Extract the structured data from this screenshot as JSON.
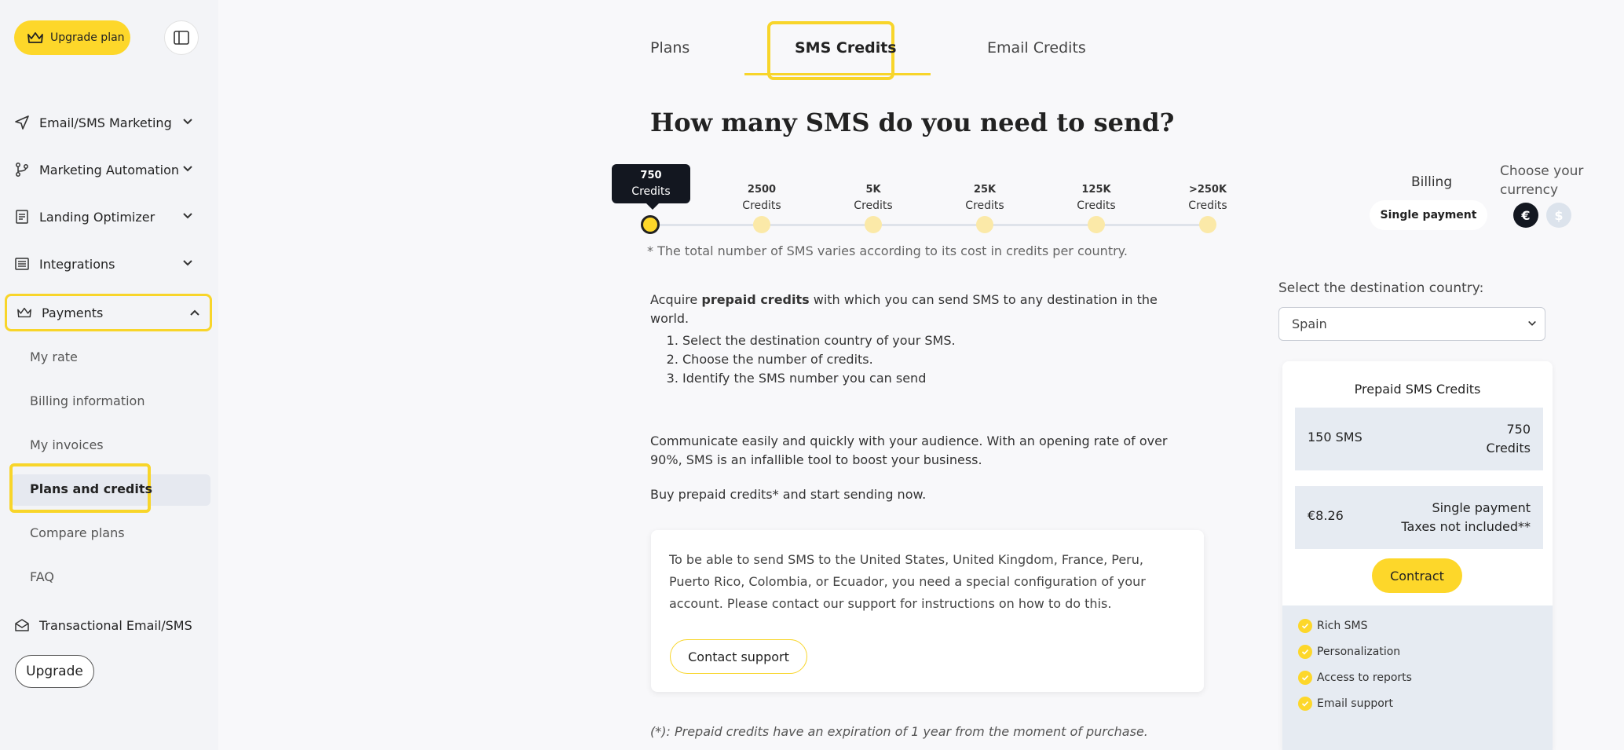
{
  "sidebar": {
    "upgrade_plan_label": "Upgrade plan",
    "nav": [
      {
        "label": "Email/SMS Marketing"
      },
      {
        "label": "Marketing Automation"
      },
      {
        "label": "Landing Optimizer"
      },
      {
        "label": "Integrations"
      },
      {
        "label": "Payments"
      }
    ],
    "payments_sub": [
      "My rate",
      "Billing information",
      "My invoices",
      "Plans and credits",
      "Compare plans",
      "FAQ"
    ],
    "transactional_label": "Transactional Email/SMS",
    "upgrade_label": "Upgrade"
  },
  "tabs": [
    "Plans",
    "SMS Credits",
    "Email Credits"
  ],
  "heading": "How many SMS do you need to send?",
  "slider": {
    "ticks": [
      {
        "num": "750",
        "unit": "Credits"
      },
      {
        "num": "2500",
        "unit": "Credits"
      },
      {
        "num": "5K",
        "unit": "Credits"
      },
      {
        "num": "25K",
        "unit": "Credits"
      },
      {
        "num": "125K",
        "unit": "Credits"
      },
      {
        "num": ">250K",
        "unit": "Credits"
      }
    ],
    "selected_index": 0
  },
  "footnote": "* The total number of SMS varies according to its cost in credits per country.",
  "intro": {
    "pre": "Acquire ",
    "bold": "prepaid credits",
    "post": " with which you can send SMS to any destination in the world."
  },
  "steps": [
    "Select the destination country of your SMS.",
    "Choose the number of credits.",
    "Identify the SMS number you can send"
  ],
  "paragraph1": "Communicate easily and quickly with your audience. With an opening rate of over 90%, SMS is an infallible tool to boost your business.",
  "paragraph2": "Buy prepaid credits* and start sending now.",
  "info_card": {
    "text": "To be able to send SMS to the United States, United Kingdom, France, Peru, Puerto Rico, Colombia, or Ecuador, you need a special configuration of your account. Please contact our support for instructions on how to do this.",
    "button": "Contact support"
  },
  "expiration": "(*): Prepaid credits have an expiration of 1 year from the moment of purchase.",
  "billing": {
    "label": "Billing",
    "value": "Single payment",
    "currency_label": "Choose your currency",
    "currencies": [
      "€",
      "$"
    ]
  },
  "destination": {
    "label": "Select the destination country:",
    "value": "Spain"
  },
  "price_card": {
    "title": "Prepaid SMS Credits",
    "sms": "150 SMS",
    "credits_line1": "750",
    "credits_line2": "Credits",
    "price": "€8.26",
    "payment_line1": "Single payment",
    "payment_line2": "Taxes not included**",
    "contract": "Contract",
    "features": [
      "Rich SMS",
      "Personalization",
      "Access to reports",
      "Email support"
    ]
  },
  "colors": {
    "accent": "#fdd72a",
    "dark": "#131720",
    "sidebar_bg": "#f3f4f7"
  }
}
